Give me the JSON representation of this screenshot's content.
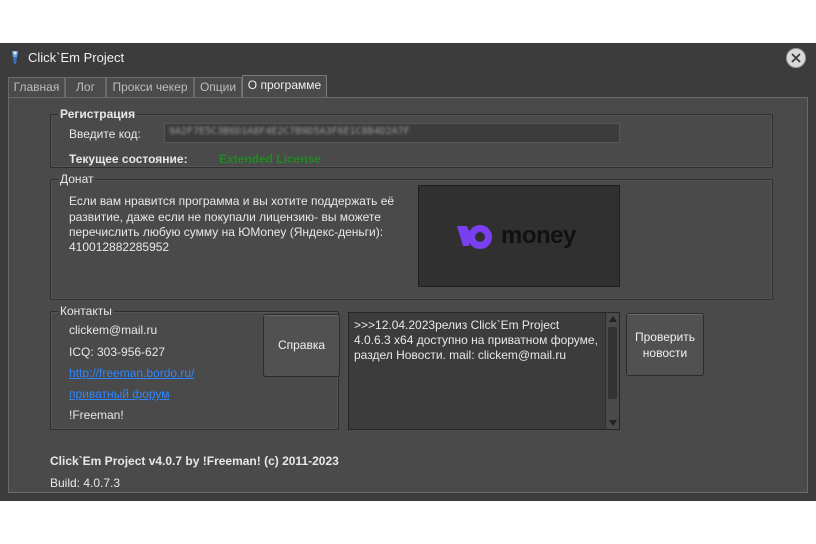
{
  "window": {
    "title": "Click`Em Project"
  },
  "tabs": [
    {
      "label": "Главная"
    },
    {
      "label": "Лог"
    },
    {
      "label": "Прокси чекер"
    },
    {
      "label": "Опции"
    },
    {
      "label": "О программе"
    }
  ],
  "registration": {
    "title": "Регистрация",
    "key_label": "Введите код:",
    "key_value": "9A2F7E5C3B6D1A8F4E2C7B9D5A3F6E1C8B4D2A7F",
    "state_label": "Текущее состояние:",
    "state_value": "Extended License"
  },
  "donate": {
    "title": "Донат",
    "lines": [
      "Если вам нравится программа и вы хотите поддержать её",
      "развитие, даже если не покупали лицензию- вы можете",
      "перечислить любую сумму на  ЮMoney (Яндекс-деньги):",
      "410012882285952"
    ],
    "logo_text": "money"
  },
  "contacts": {
    "title": "Контакты",
    "email": "clickem@mail.ru",
    "icq": "ICQ: 303-956-627",
    "site_link": "http://freeman.bordo.ru/",
    "forum_link": "приватный форум",
    "author": "!Freeman!",
    "help_button": "Справка"
  },
  "news": {
    "text": ">>>12.04.2023релиз Click`Em Project 4.0.6.3 x64 доступно на приватном форуме, раздел Новости. mail: clickem@mail.ru",
    "check_button_line1": "Проверить",
    "check_button_line2": "новости"
  },
  "footer": {
    "copyright": "Click`Em Project v4.0.7 by !Freeman! (c) 2011-2023",
    "build": "Build: 4.0.7.3"
  }
}
